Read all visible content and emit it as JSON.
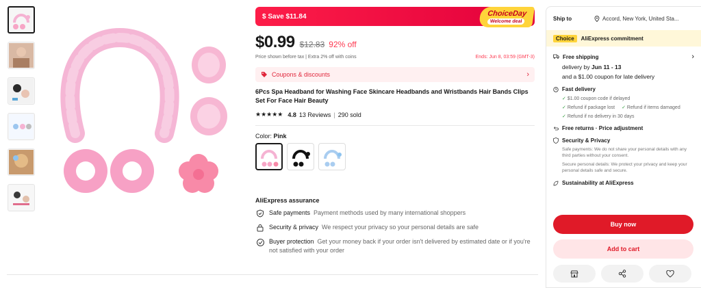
{
  "promo": {
    "save_label": "$ Save $11.84",
    "badge_top": "ChoiceDay",
    "badge_bottom": "Welcome deal"
  },
  "price": {
    "current": "$0.99",
    "original": "$12.83",
    "discount": "92% off",
    "tax_note": "Price shown before tax  |  Extra 2% off with coins",
    "ends": "Ends: Jun 8, 03:59 (GMT-3)"
  },
  "coupons": {
    "label": "Coupons & discounts"
  },
  "product": {
    "title": "6Pcs Spa Headband for Washing Face Skincare Headbands and Wristbands Hair Bands Clips Set For Face Hair Beauty",
    "stars": "★★★★★",
    "rating": "4.8",
    "reviews": "13 Reviews",
    "sep": "|",
    "sold": "290 sold"
  },
  "color": {
    "label": "Color:",
    "selected": "Pink"
  },
  "assurance": {
    "title": "AliExpress assurance",
    "items": [
      {
        "title": "Safe payments",
        "text": "Payment methods used by many international shoppers"
      },
      {
        "title": "Security & privacy",
        "text": "We respect your privacy so your personal details are safe"
      },
      {
        "title": "Buyer protection",
        "text": "Get your money back if your order isn't delivered by estimated date or if you're not satisfied with your order"
      }
    ]
  },
  "right": {
    "ship_label": "Ship to",
    "ship_value": "Accord, New York, United Sta...",
    "choice_badge": "Choice",
    "commitment": "AliExpress commitment",
    "free_shipping": "Free shipping",
    "delivery_prefix": "delivery by",
    "delivery_date": "Jun 11 - 13",
    "late_coupon": "and a $1.00 coupon for late delivery",
    "fast_delivery": "Fast delivery",
    "checks": [
      "$1.00 coupon code if delayed",
      "Refund if package lost",
      "Refund if items damaged",
      "Refund if no delivery in 30 days"
    ],
    "free_returns": "Free returns · Price adjustment",
    "security_title": "Security & Privacy",
    "security_text1": "Safe payments: We do not share your personal details with any third parties without your consent.",
    "security_text2": "Secure personal details: We protect your privacy and keep your personal details safe and secure.",
    "sustainability": "Sustainability at AliExpress",
    "buy_now": "Buy now",
    "add_to_cart": "Add to cart"
  },
  "colors": {
    "accent": "#e01a28",
    "pink": "#f5b3d3",
    "choice_yellow": "#ffd43a"
  },
  "icons": [
    "store-icon",
    "share-icon",
    "heart-icon",
    "location-icon",
    "shield-icon",
    "lock-icon",
    "truck-icon",
    "return-icon",
    "leaf-icon"
  ]
}
